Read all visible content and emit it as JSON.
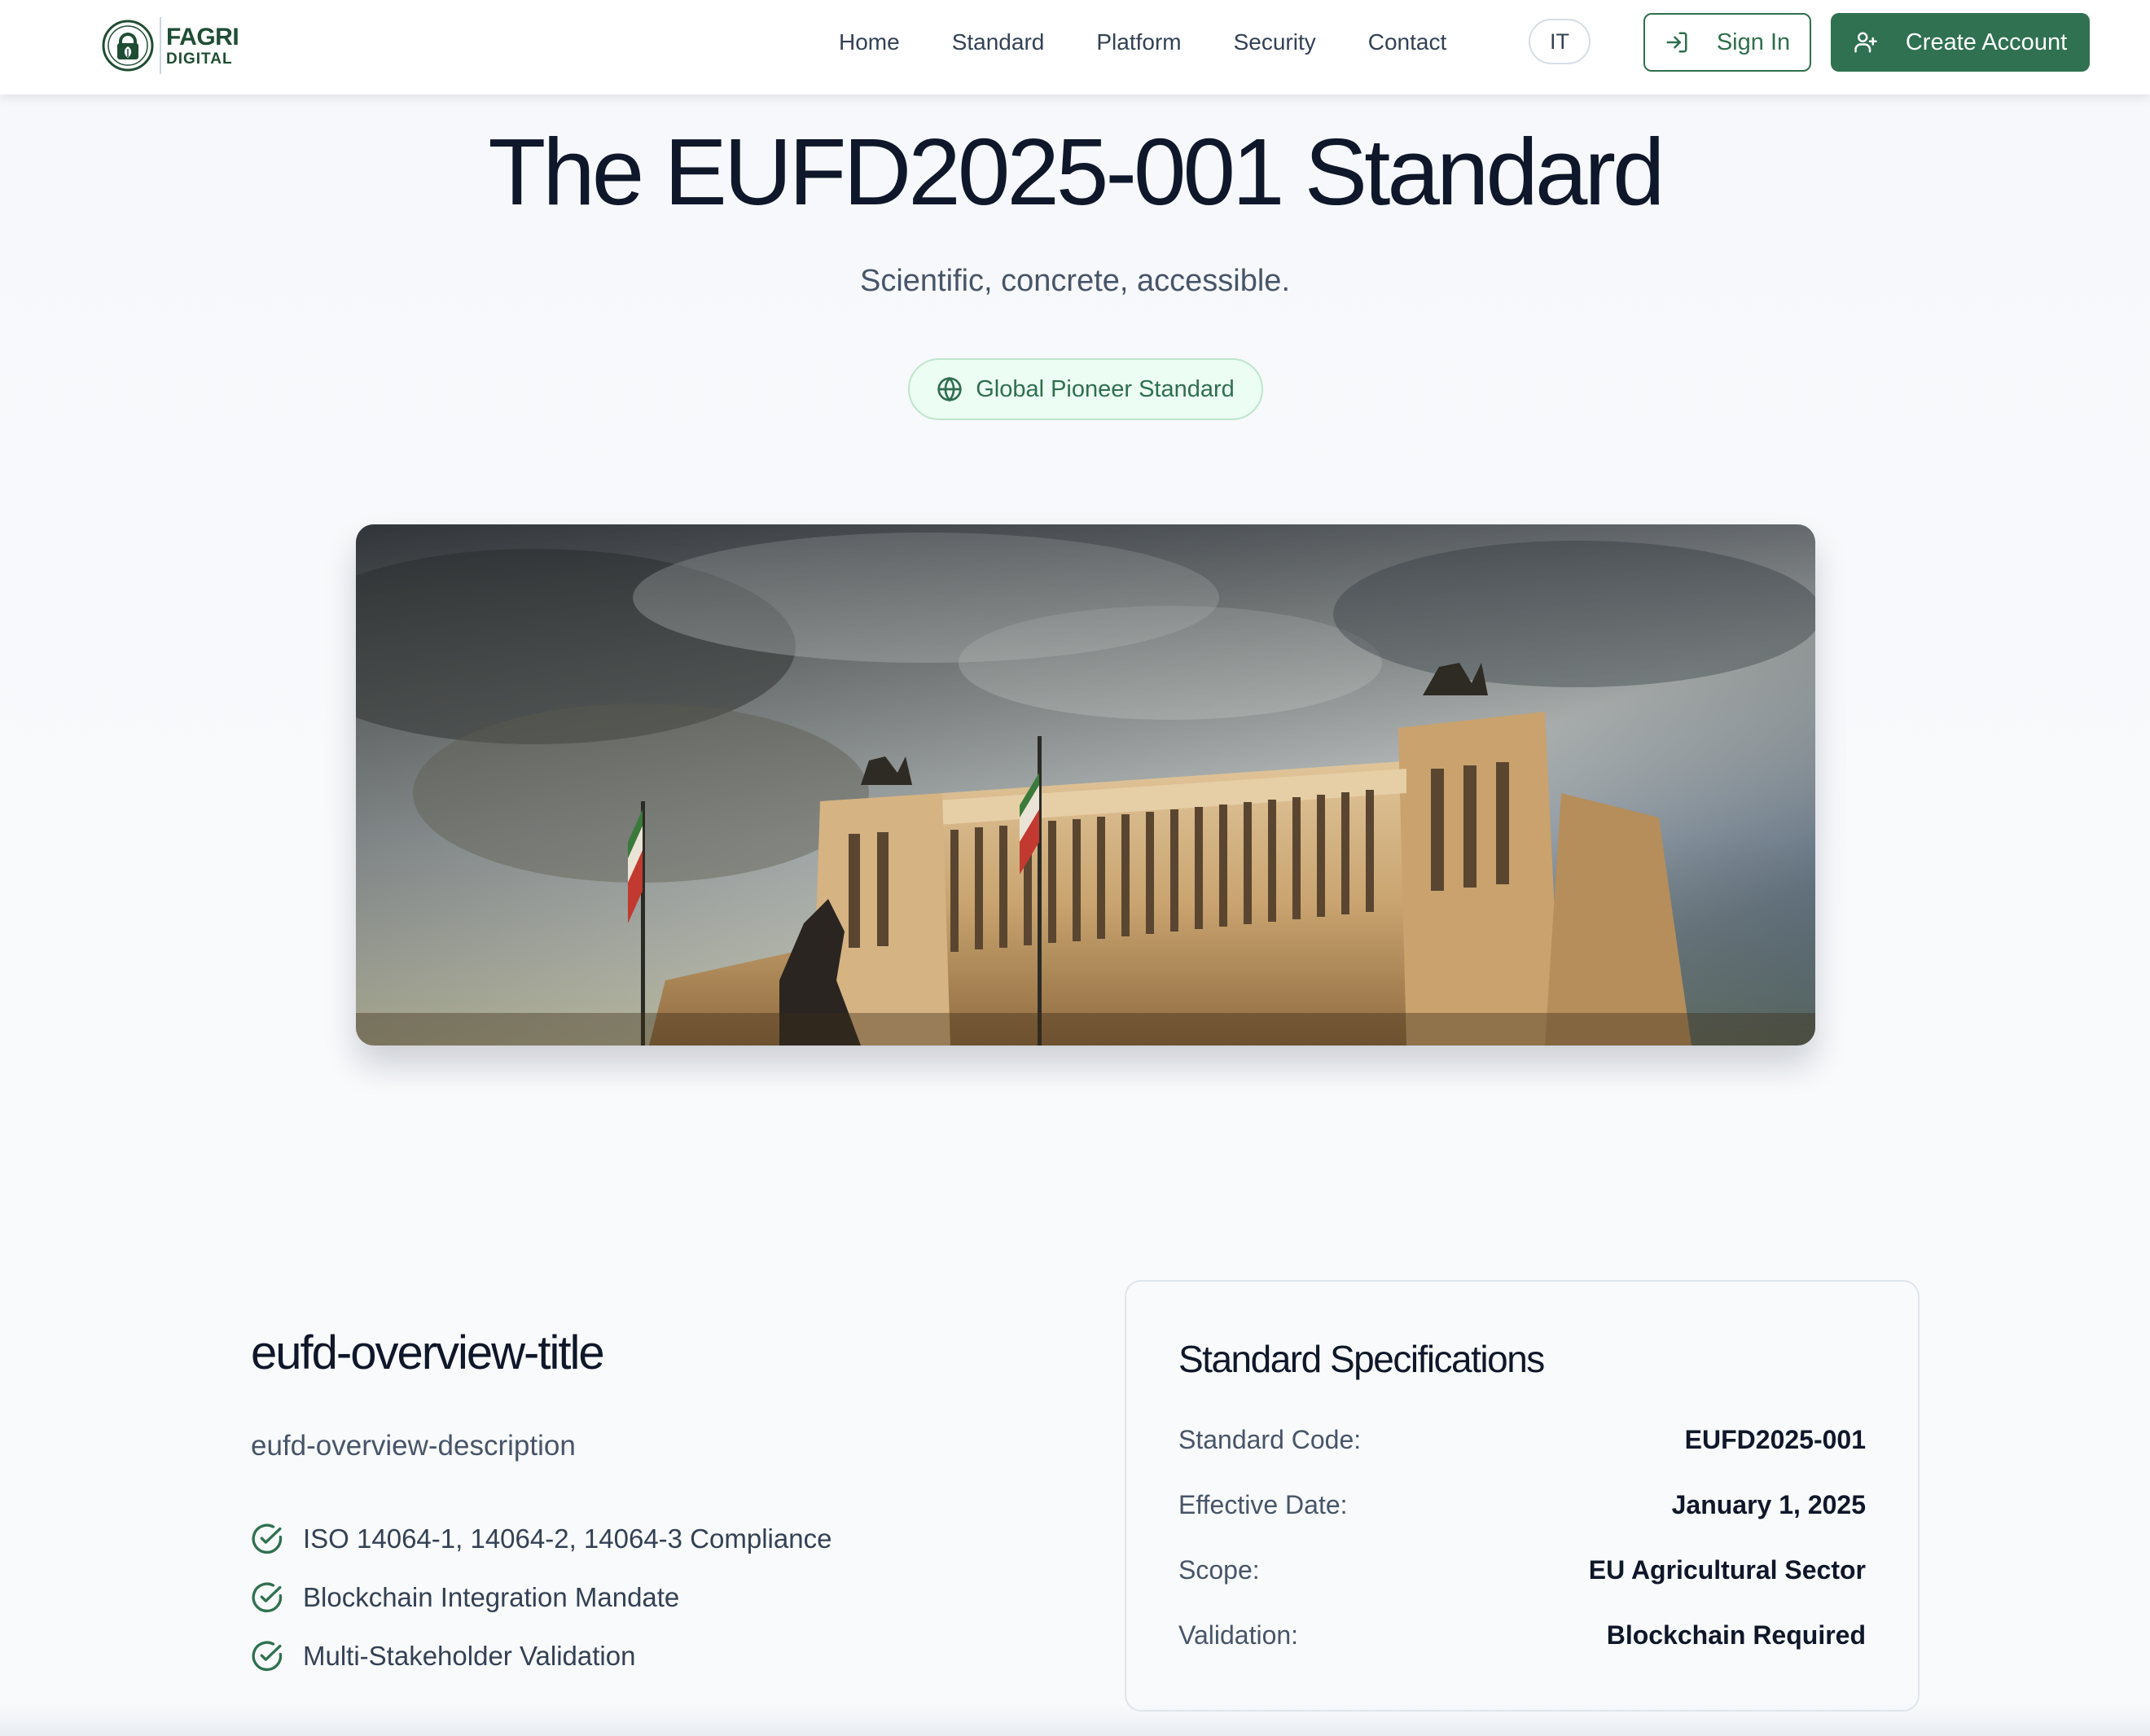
{
  "header": {
    "logo": {
      "line1": "FAGRI",
      "line2": "DIGITAL"
    },
    "nav": [
      "Home",
      "Standard",
      "Platform",
      "Security",
      "Contact"
    ],
    "language": "IT",
    "sign_in": "Sign In",
    "create_account": "Create Account"
  },
  "hero": {
    "title": "The EUFD2025-001 Standard",
    "subtitle": "Scientific, concrete, accessible.",
    "badge": "Global Pioneer Standard",
    "badge_icon": "globe-icon"
  },
  "overview": {
    "title": "eufd-overview-title",
    "description": "eufd-overview-description",
    "items": [
      "ISO 14064-1, 14064-2, 14064-3 Compliance",
      "Blockchain Integration Mandate",
      "Multi-Stakeholder Validation"
    ],
    "item_icon": "check-circle-icon"
  },
  "specs": {
    "title": "Standard Specifications",
    "rows": [
      {
        "label": "Standard Code:",
        "value": "EUFD2025-001"
      },
      {
        "label": "Effective Date:",
        "value": "January 1, 2025"
      },
      {
        "label": "Scope:",
        "value": "EU Agricultural Sector"
      },
      {
        "label": "Validation:",
        "value": "Blockchain Required"
      }
    ]
  },
  "colors": {
    "brand_green": "#2f7150",
    "badge_bg": "#ecfdf3",
    "text_dark": "#0f172a",
    "text_muted": "#475569"
  }
}
